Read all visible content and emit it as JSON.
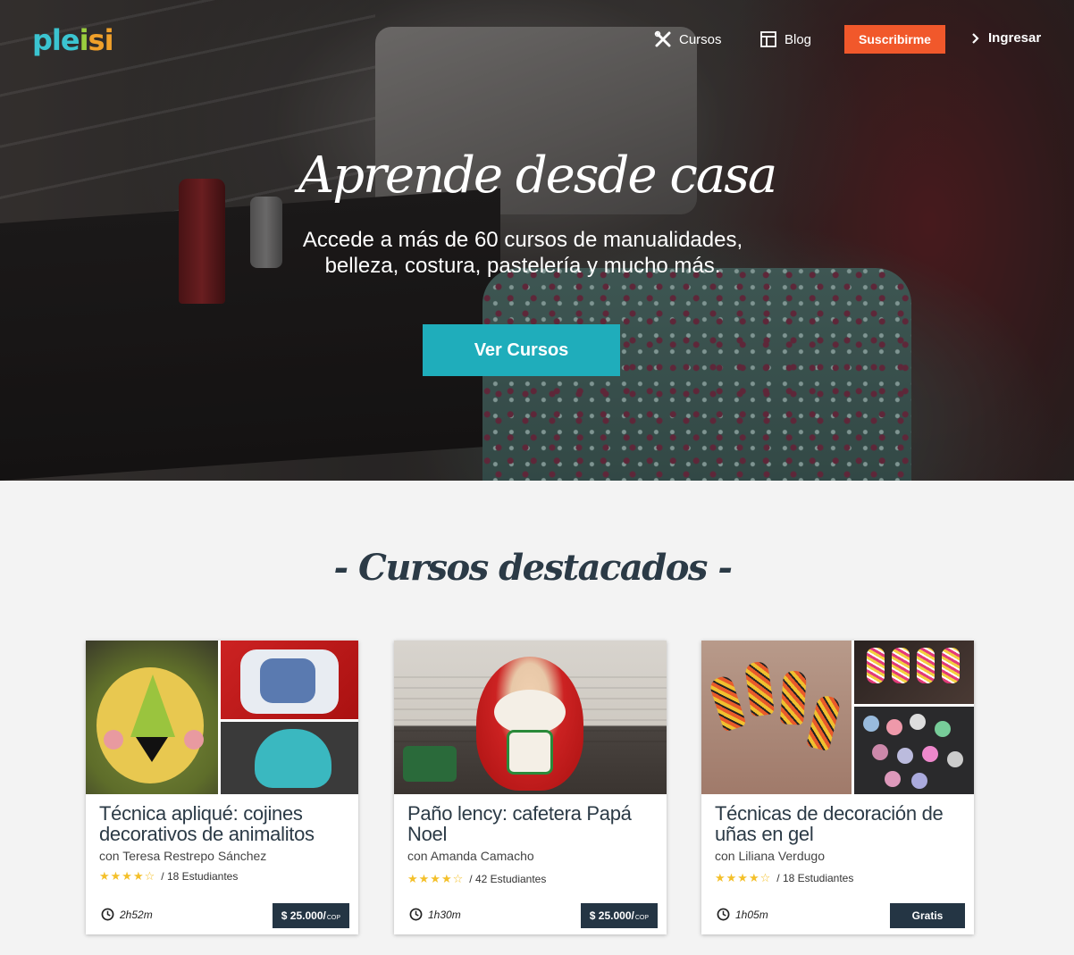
{
  "brand": {
    "logo_parts": [
      "ple",
      "i",
      "si"
    ]
  },
  "nav": {
    "cursos": "Cursos",
    "blog": "Blog",
    "suscribirme": "Suscribirme",
    "ingresar": "Ingresar"
  },
  "hero": {
    "title": "Aprende desde casa",
    "subtitle_line1": "Accede a más de 60 cursos de manualidades,",
    "subtitle_line2": "belleza, costura, pastelería y mucho más.",
    "cta": "Ver Cursos"
  },
  "section": {
    "title": "- Cursos destacados -"
  },
  "courses": [
    {
      "title": "Técnica apliqué: cojines decorativos de animalitos",
      "author": "con Teresa Restrepo Sánchez",
      "rating": 4,
      "students": "/ 18 Estudiantes",
      "duration": "2h52m",
      "price": "$ 25.000/",
      "currency": "COP"
    },
    {
      "title": "Paño lency: cafetera Papá Noel",
      "author": "con Amanda Camacho",
      "rating": 4,
      "students": "/ 42 Estudiantes",
      "duration": "1h30m",
      "price": "$ 25.000/",
      "currency": "COP"
    },
    {
      "title": "Técnicas de decoración de uñas en gel",
      "author": "con Liliana Verdugo",
      "rating": 4,
      "students": "/ 18 Estudiantes",
      "duration": "1h05m",
      "price": "Gratis",
      "currency": ""
    }
  ],
  "colors": {
    "accent_teal": "#1fadbb",
    "subscribe_orange": "#f1582b",
    "price_navy": "#243544",
    "star_yellow": "#f4c02a"
  },
  "icons": [
    "tools-icon",
    "blog-icon",
    "chevron-right-icon",
    "clock-icon",
    "star-icon"
  ]
}
